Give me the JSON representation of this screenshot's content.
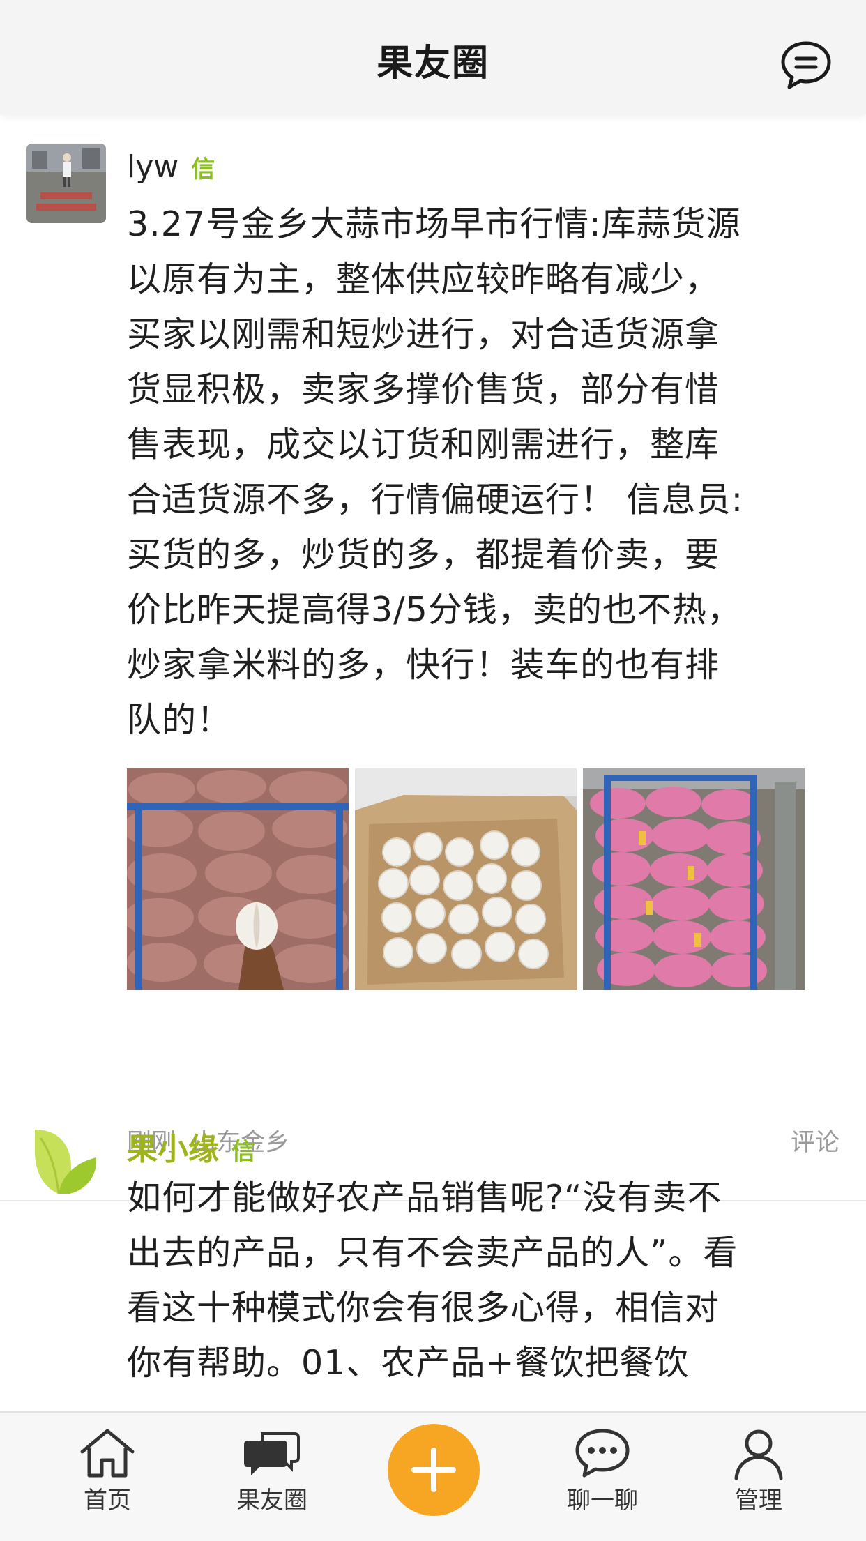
{
  "header": {
    "title": "果友圈"
  },
  "posts": [
    {
      "author": "lyw",
      "badge": "信",
      "text": "3.27号金乡大蒜市场早市行情:库蒜货源\n以原有为主，整体供应较昨略有减少，\n买家以刚需和短炒进行，对合适货源拿\n货显积极，卖家多撑价售货，部分有惜\n售表现，成交以订货和刚需进行，整库\n合适货源不多，行情偏硬运行！  信息员:\n买货的多，炒货的多，都提着价卖，要\n价比昨天提高得3/5分钱，卖的也不热，\n炒家拿米料的多，快行！装车的也有排\n队的！",
      "time": "刚刚",
      "location": "山东金乡",
      "comment_label": "评论"
    },
    {
      "author": "果小缘",
      "badge": "信",
      "text": "如何才能做好农产品销售呢?“没有卖不\n出去的产品，只有不会卖产品的人”。看\n看这十种模式你会有很多心得，相信对\n你有帮助。01、农产品+餐饮把餐饮"
    }
  ],
  "tabbar": {
    "items": [
      {
        "label": "首页"
      },
      {
        "label": "果友圈"
      },
      {
        "label": "聊一聊"
      },
      {
        "label": "管理"
      }
    ]
  },
  "colors": {
    "accent": "#f6a623",
    "brand_green": "#9fb31a",
    "badge_green": "#8dbf22"
  }
}
